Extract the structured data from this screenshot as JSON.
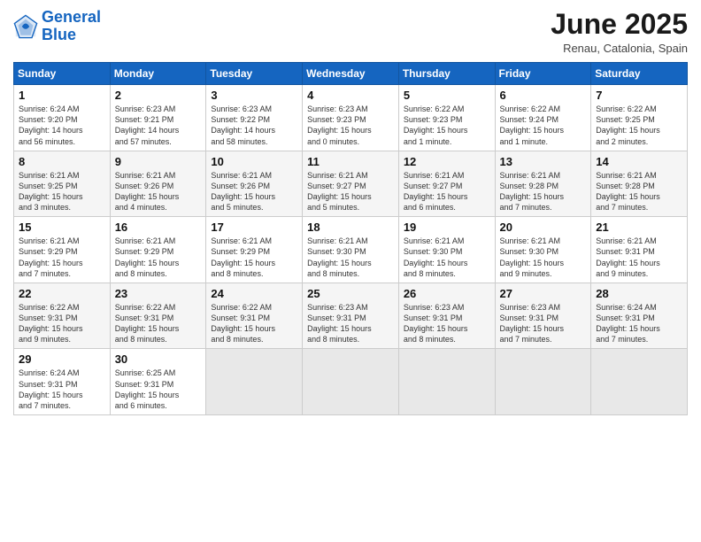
{
  "header": {
    "logo_line1": "General",
    "logo_line2": "Blue",
    "month": "June 2025",
    "location": "Renau, Catalonia, Spain"
  },
  "weekdays": [
    "Sunday",
    "Monday",
    "Tuesday",
    "Wednesday",
    "Thursday",
    "Friday",
    "Saturday"
  ],
  "weeks": [
    [
      {
        "day": "1",
        "info": "Sunrise: 6:24 AM\nSunset: 9:20 PM\nDaylight: 14 hours\nand 56 minutes."
      },
      {
        "day": "2",
        "info": "Sunrise: 6:23 AM\nSunset: 9:21 PM\nDaylight: 14 hours\nand 57 minutes."
      },
      {
        "day": "3",
        "info": "Sunrise: 6:23 AM\nSunset: 9:22 PM\nDaylight: 14 hours\nand 58 minutes."
      },
      {
        "day": "4",
        "info": "Sunrise: 6:23 AM\nSunset: 9:23 PM\nDaylight: 15 hours\nand 0 minutes."
      },
      {
        "day": "5",
        "info": "Sunrise: 6:22 AM\nSunset: 9:23 PM\nDaylight: 15 hours\nand 1 minute."
      },
      {
        "day": "6",
        "info": "Sunrise: 6:22 AM\nSunset: 9:24 PM\nDaylight: 15 hours\nand 1 minute."
      },
      {
        "day": "7",
        "info": "Sunrise: 6:22 AM\nSunset: 9:25 PM\nDaylight: 15 hours\nand 2 minutes."
      }
    ],
    [
      {
        "day": "8",
        "info": "Sunrise: 6:21 AM\nSunset: 9:25 PM\nDaylight: 15 hours\nand 3 minutes."
      },
      {
        "day": "9",
        "info": "Sunrise: 6:21 AM\nSunset: 9:26 PM\nDaylight: 15 hours\nand 4 minutes."
      },
      {
        "day": "10",
        "info": "Sunrise: 6:21 AM\nSunset: 9:26 PM\nDaylight: 15 hours\nand 5 minutes."
      },
      {
        "day": "11",
        "info": "Sunrise: 6:21 AM\nSunset: 9:27 PM\nDaylight: 15 hours\nand 5 minutes."
      },
      {
        "day": "12",
        "info": "Sunrise: 6:21 AM\nSunset: 9:27 PM\nDaylight: 15 hours\nand 6 minutes."
      },
      {
        "day": "13",
        "info": "Sunrise: 6:21 AM\nSunset: 9:28 PM\nDaylight: 15 hours\nand 7 minutes."
      },
      {
        "day": "14",
        "info": "Sunrise: 6:21 AM\nSunset: 9:28 PM\nDaylight: 15 hours\nand 7 minutes."
      }
    ],
    [
      {
        "day": "15",
        "info": "Sunrise: 6:21 AM\nSunset: 9:29 PM\nDaylight: 15 hours\nand 7 minutes."
      },
      {
        "day": "16",
        "info": "Sunrise: 6:21 AM\nSunset: 9:29 PM\nDaylight: 15 hours\nand 8 minutes."
      },
      {
        "day": "17",
        "info": "Sunrise: 6:21 AM\nSunset: 9:29 PM\nDaylight: 15 hours\nand 8 minutes."
      },
      {
        "day": "18",
        "info": "Sunrise: 6:21 AM\nSunset: 9:30 PM\nDaylight: 15 hours\nand 8 minutes."
      },
      {
        "day": "19",
        "info": "Sunrise: 6:21 AM\nSunset: 9:30 PM\nDaylight: 15 hours\nand 8 minutes."
      },
      {
        "day": "20",
        "info": "Sunrise: 6:21 AM\nSunset: 9:30 PM\nDaylight: 15 hours\nand 9 minutes."
      },
      {
        "day": "21",
        "info": "Sunrise: 6:21 AM\nSunset: 9:31 PM\nDaylight: 15 hours\nand 9 minutes."
      }
    ],
    [
      {
        "day": "22",
        "info": "Sunrise: 6:22 AM\nSunset: 9:31 PM\nDaylight: 15 hours\nand 9 minutes."
      },
      {
        "day": "23",
        "info": "Sunrise: 6:22 AM\nSunset: 9:31 PM\nDaylight: 15 hours\nand 8 minutes."
      },
      {
        "day": "24",
        "info": "Sunrise: 6:22 AM\nSunset: 9:31 PM\nDaylight: 15 hours\nand 8 minutes."
      },
      {
        "day": "25",
        "info": "Sunrise: 6:23 AM\nSunset: 9:31 PM\nDaylight: 15 hours\nand 8 minutes."
      },
      {
        "day": "26",
        "info": "Sunrise: 6:23 AM\nSunset: 9:31 PM\nDaylight: 15 hours\nand 8 minutes."
      },
      {
        "day": "27",
        "info": "Sunrise: 6:23 AM\nSunset: 9:31 PM\nDaylight: 15 hours\nand 7 minutes."
      },
      {
        "day": "28",
        "info": "Sunrise: 6:24 AM\nSunset: 9:31 PM\nDaylight: 15 hours\nand 7 minutes."
      }
    ],
    [
      {
        "day": "29",
        "info": "Sunrise: 6:24 AM\nSunset: 9:31 PM\nDaylight: 15 hours\nand 7 minutes."
      },
      {
        "day": "30",
        "info": "Sunrise: 6:25 AM\nSunset: 9:31 PM\nDaylight: 15 hours\nand 6 minutes."
      },
      {
        "day": "",
        "info": ""
      },
      {
        "day": "",
        "info": ""
      },
      {
        "day": "",
        "info": ""
      },
      {
        "day": "",
        "info": ""
      },
      {
        "day": "",
        "info": ""
      }
    ]
  ]
}
